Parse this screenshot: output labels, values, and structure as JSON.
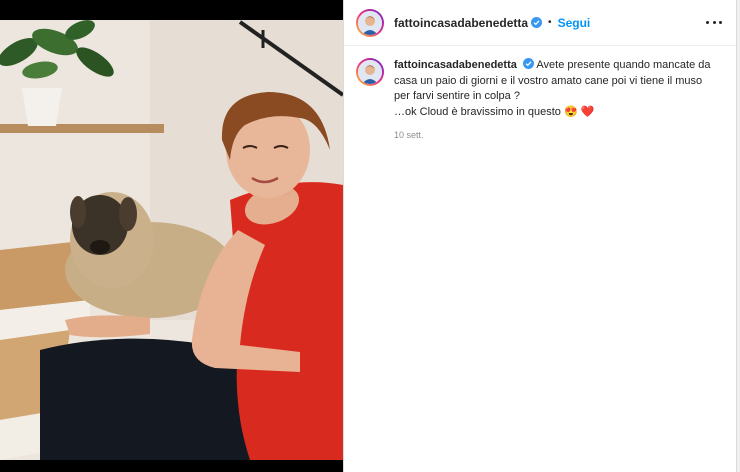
{
  "post": {
    "username": "fattoincasadabenedetta",
    "follow_label": "Segui",
    "separator": "•",
    "caption_lines": [
      "Avete presente quando mancate da",
      "casa un paio di giorni e il vostro amato cane poi vi tiene il muso",
      "per farvi sentire in colpa ?",
      "…ok Cloud è bravissimo in questo 😍 ❤️"
    ],
    "timestamp": "10 sett."
  },
  "icons": {
    "verified": "verified-badge-icon",
    "more": "more-options-icon"
  },
  "colors": {
    "follow_blue": "#0095f6",
    "shirt_red": "#d92a1f",
    "verified_blue": "#3897f0"
  }
}
